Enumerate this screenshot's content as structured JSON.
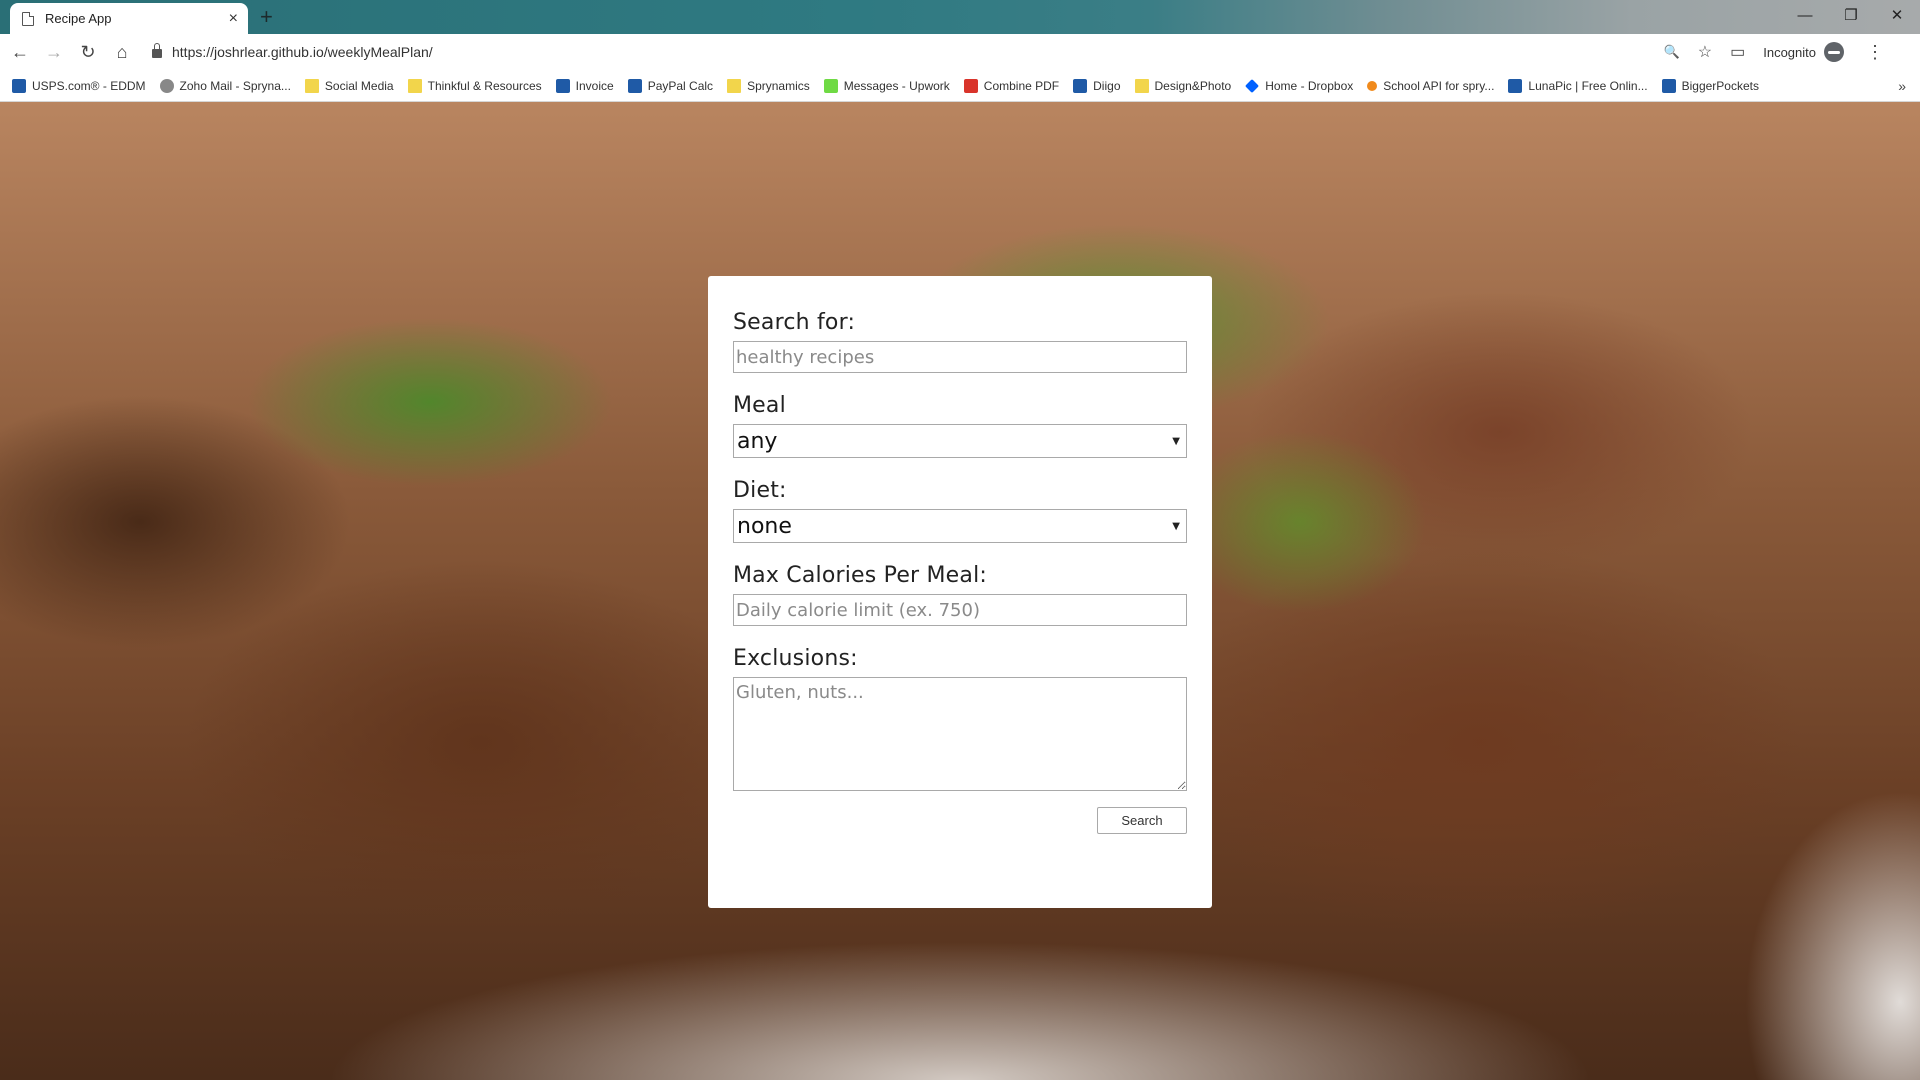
{
  "browser": {
    "tab_title": "Recipe App",
    "tab_close": "×",
    "new_tab": "+",
    "window_controls": [
      "—",
      "❐",
      "✕"
    ],
    "url": "https://joshrlear.github.io/weeklyMealPlan/",
    "incognito_label": "Incognito",
    "nav": {
      "back": "←",
      "forward": "→",
      "reload": "↻",
      "home": "⌂"
    },
    "omni_icons": {
      "zoom": "🔍",
      "star": "☆",
      "cast": "▭"
    },
    "menu": "⋮",
    "bookmarks_more": "»"
  },
  "bookmarks": [
    {
      "label": "USPS.com® - EDDM",
      "icon": "usps-icon",
      "kind": "blue"
    },
    {
      "label": "Zoho Mail - Spryna...",
      "icon": "zoho-mail-icon",
      "kind": "grey"
    },
    {
      "label": "Social Media",
      "icon": "folder-icon",
      "kind": "folder"
    },
    {
      "label": "Thinkful & Resources",
      "icon": "folder-icon",
      "kind": "folder"
    },
    {
      "label": "Invoice",
      "icon": "paypal-icon",
      "kind": "blue"
    },
    {
      "label": "PayPal Calc",
      "icon": "calculator-icon",
      "kind": "blue"
    },
    {
      "label": "Sprynamics",
      "icon": "folder-icon",
      "kind": "folder"
    },
    {
      "label": "Messages - Upwork",
      "icon": "upwork-icon",
      "kind": "green"
    },
    {
      "label": "Combine PDF",
      "icon": "pdf-icon",
      "kind": "red"
    },
    {
      "label": "Diigo",
      "icon": "diigo-icon",
      "kind": "blue"
    },
    {
      "label": "Design&Photo",
      "icon": "folder-icon",
      "kind": "folder"
    },
    {
      "label": "Home - Dropbox",
      "icon": "dropbox-icon",
      "kind": "dropbox"
    },
    {
      "label": "School API for spry...",
      "icon": "school-api-icon",
      "kind": "orange"
    },
    {
      "label": "LunaPic | Free Onlin...",
      "icon": "lunapic-icon",
      "kind": "blue"
    },
    {
      "label": "BiggerPockets",
      "icon": "biggerpockets-icon",
      "kind": "blue"
    }
  ],
  "form": {
    "search_label": "Search for:",
    "search_placeholder": "healthy recipes",
    "meal_label": "Meal",
    "meal_selected": "any",
    "diet_label": "Diet:",
    "diet_selected": "none",
    "calories_label": "Max Calories Per Meal:",
    "calories_placeholder": "Daily calorie limit (ex. 750)",
    "exclusions_label": "Exclusions:",
    "exclusions_placeholder": "Gluten, nuts...",
    "search_button": "Search",
    "select_arrow": "▼"
  }
}
